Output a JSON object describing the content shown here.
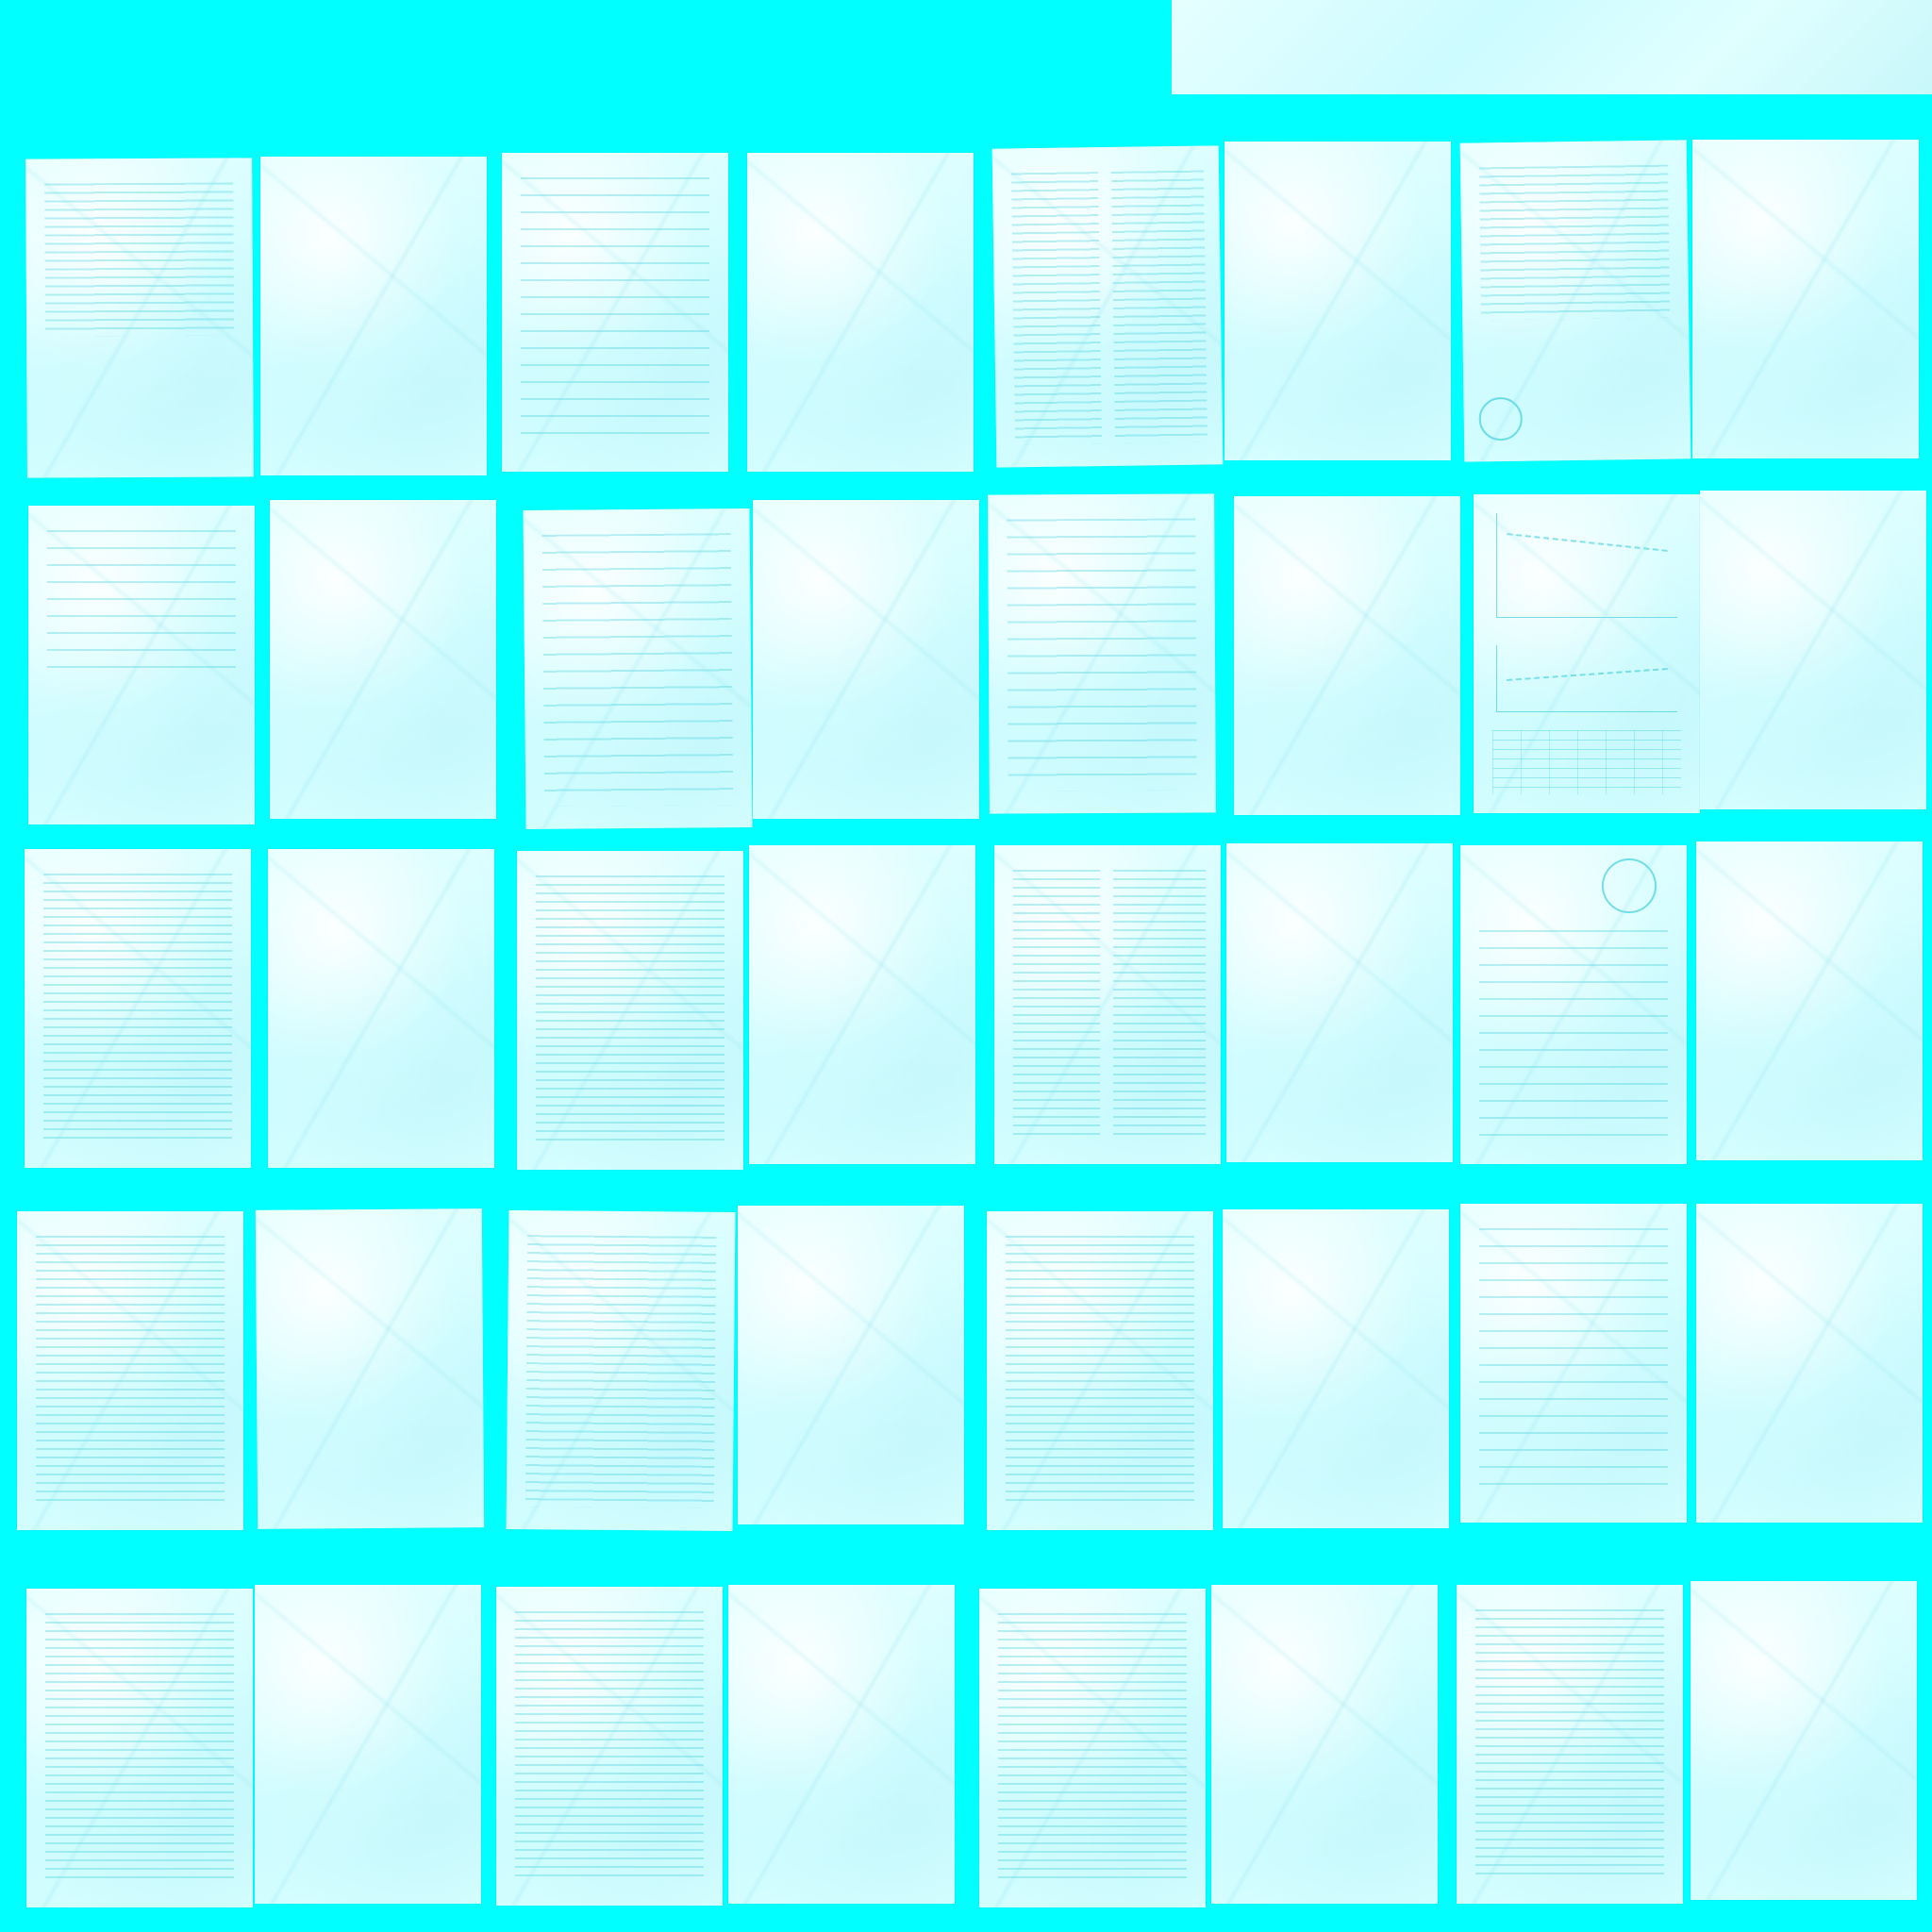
{
  "colors": {
    "background": "#00ffff",
    "paper": "#e6ffff",
    "ink": "#28c8d7"
  },
  "pages": [
    {
      "id": "r1c1",
      "kind": "text"
    },
    {
      "id": "r1c2",
      "kind": "blank"
    },
    {
      "id": "r1c3",
      "kind": "text-sparse"
    },
    {
      "id": "r1c4",
      "kind": "blank"
    },
    {
      "id": "r1c5",
      "kind": "two-column-figure"
    },
    {
      "id": "r1c6",
      "kind": "blank"
    },
    {
      "id": "r1c7",
      "kind": "letter-with-seal"
    },
    {
      "id": "r1c8",
      "kind": "blank"
    },
    {
      "id": "r2c1",
      "kind": "text-short"
    },
    {
      "id": "r2c2",
      "kind": "blank"
    },
    {
      "id": "r2c3",
      "kind": "form"
    },
    {
      "id": "r2c4",
      "kind": "blank"
    },
    {
      "id": "r2c5",
      "kind": "form-inverted"
    },
    {
      "id": "r2c6",
      "kind": "blank"
    },
    {
      "id": "r2c7",
      "kind": "charts-and-table"
    },
    {
      "id": "r2c8",
      "kind": "blank"
    },
    {
      "id": "r3c1",
      "kind": "text"
    },
    {
      "id": "r3c2",
      "kind": "blank"
    },
    {
      "id": "r3c3",
      "kind": "text"
    },
    {
      "id": "r3c4",
      "kind": "blank"
    },
    {
      "id": "r3c5",
      "kind": "two-column"
    },
    {
      "id": "r3c6",
      "kind": "blank"
    },
    {
      "id": "r3c7",
      "kind": "certificate-with-seal"
    },
    {
      "id": "r3c8",
      "kind": "blank"
    },
    {
      "id": "r4c1",
      "kind": "text"
    },
    {
      "id": "r4c2",
      "kind": "blank"
    },
    {
      "id": "r4c3",
      "kind": "text"
    },
    {
      "id": "r4c4",
      "kind": "blank"
    },
    {
      "id": "r4c5",
      "kind": "text"
    },
    {
      "id": "r4c6",
      "kind": "blank"
    },
    {
      "id": "r4c7",
      "kind": "list"
    },
    {
      "id": "r4c8",
      "kind": "blank"
    },
    {
      "id": "r5c1",
      "kind": "text"
    },
    {
      "id": "r5c2",
      "kind": "blank"
    },
    {
      "id": "r5c3",
      "kind": "text"
    },
    {
      "id": "r5c4",
      "kind": "blank"
    },
    {
      "id": "r5c5",
      "kind": "text"
    },
    {
      "id": "r5c6",
      "kind": "blank"
    },
    {
      "id": "r5c7",
      "kind": "text-short"
    },
    {
      "id": "r5c8",
      "kind": "blank"
    }
  ]
}
